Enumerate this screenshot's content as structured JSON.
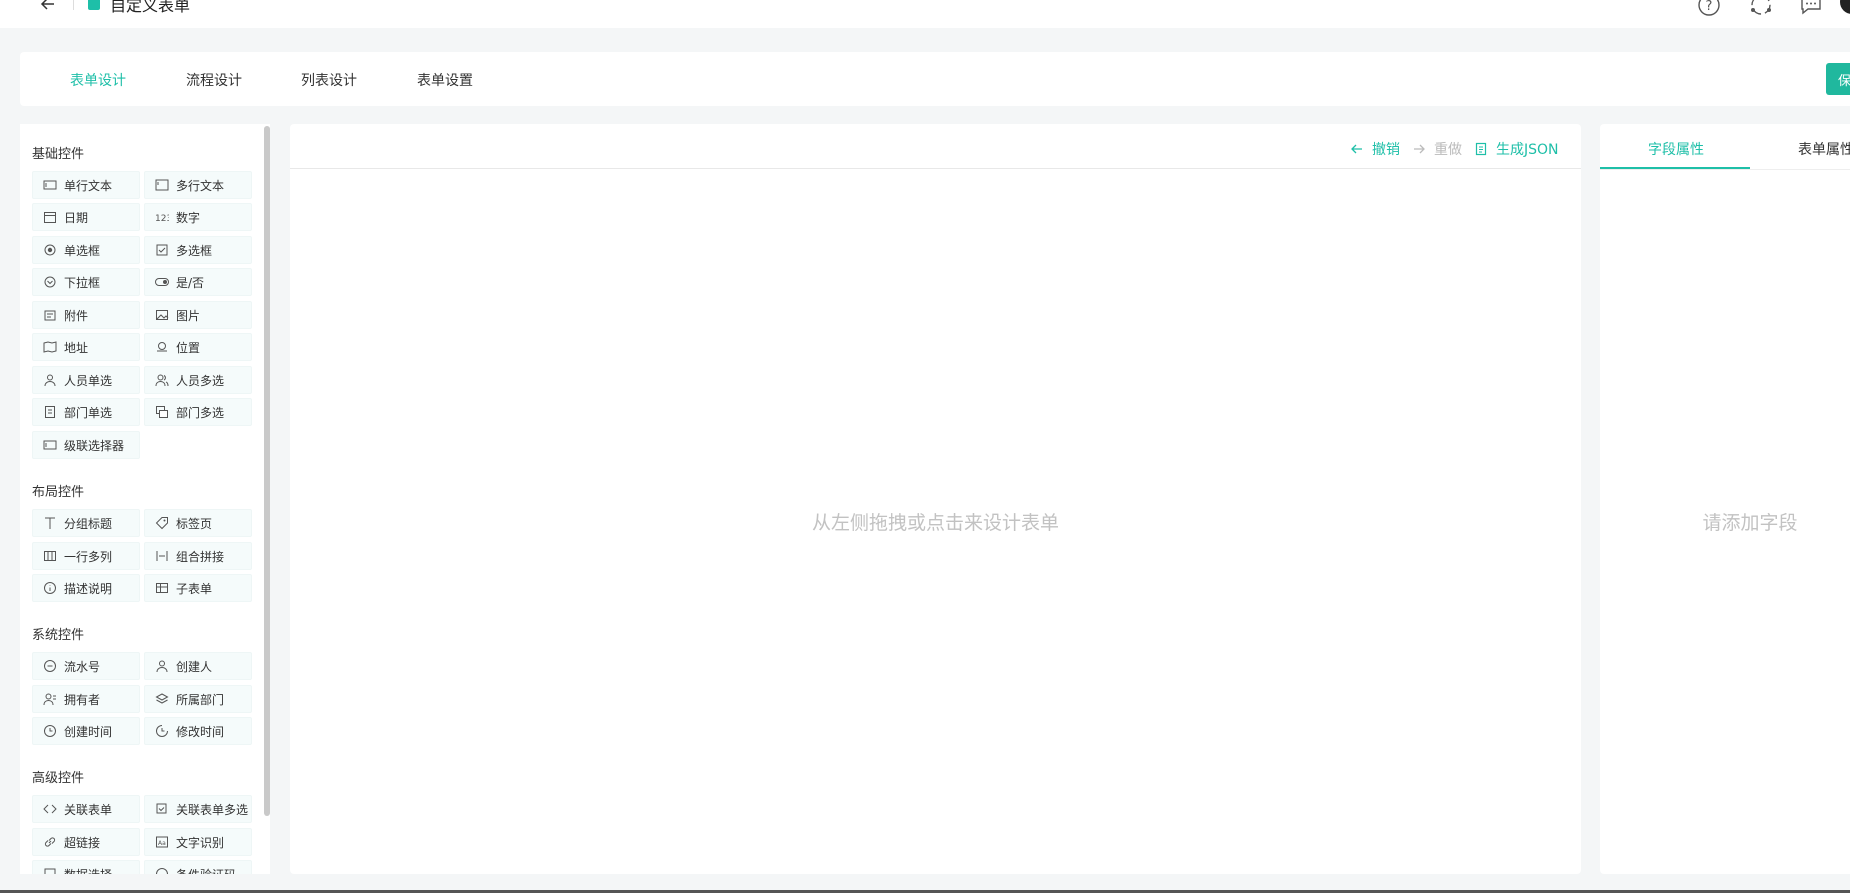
{
  "header": {
    "title": "自定义表单"
  },
  "tabs": [
    {
      "label": "表单设计",
      "active": true
    },
    {
      "label": "流程设计",
      "active": false
    },
    {
      "label": "列表设计",
      "active": false
    },
    {
      "label": "表单设置",
      "active": false
    }
  ],
  "save_label": "保",
  "left_panel": {
    "sections": [
      {
        "title": "基础控件",
        "items": [
          "单行文本",
          "多行文本",
          "日期",
          "数字",
          "单选框",
          "多选框",
          "下拉框",
          "是/否",
          "附件",
          "图片",
          "地址",
          "位置",
          "人员单选",
          "人员多选",
          "部门单选",
          "部门多选",
          "级联选择器"
        ]
      },
      {
        "title": "布局控件",
        "items": [
          "分组标题",
          "标签页",
          "一行多列",
          "组合拼接",
          "描述说明",
          "子表单"
        ]
      },
      {
        "title": "系统控件",
        "items": [
          "流水号",
          "创建人",
          "拥有者",
          "所属部门",
          "创建时间",
          "修改时间"
        ]
      },
      {
        "title": "高级控件",
        "items": [
          "关联表单",
          "关联表单多选",
          "超链接",
          "文字识别",
          "数据选择",
          "条件验证码"
        ]
      }
    ]
  },
  "canvas": {
    "toolbar": {
      "undo": "撤销",
      "redo": "重做",
      "json": "生成JSON"
    },
    "hint": "从左侧拖拽或点击来设计表单"
  },
  "right_panel": {
    "tabs": [
      "字段属性",
      "表单属性"
    ],
    "hint": "请添加字段"
  },
  "colors": {
    "accent": "#1ebfa8",
    "save": "#20b89e"
  }
}
